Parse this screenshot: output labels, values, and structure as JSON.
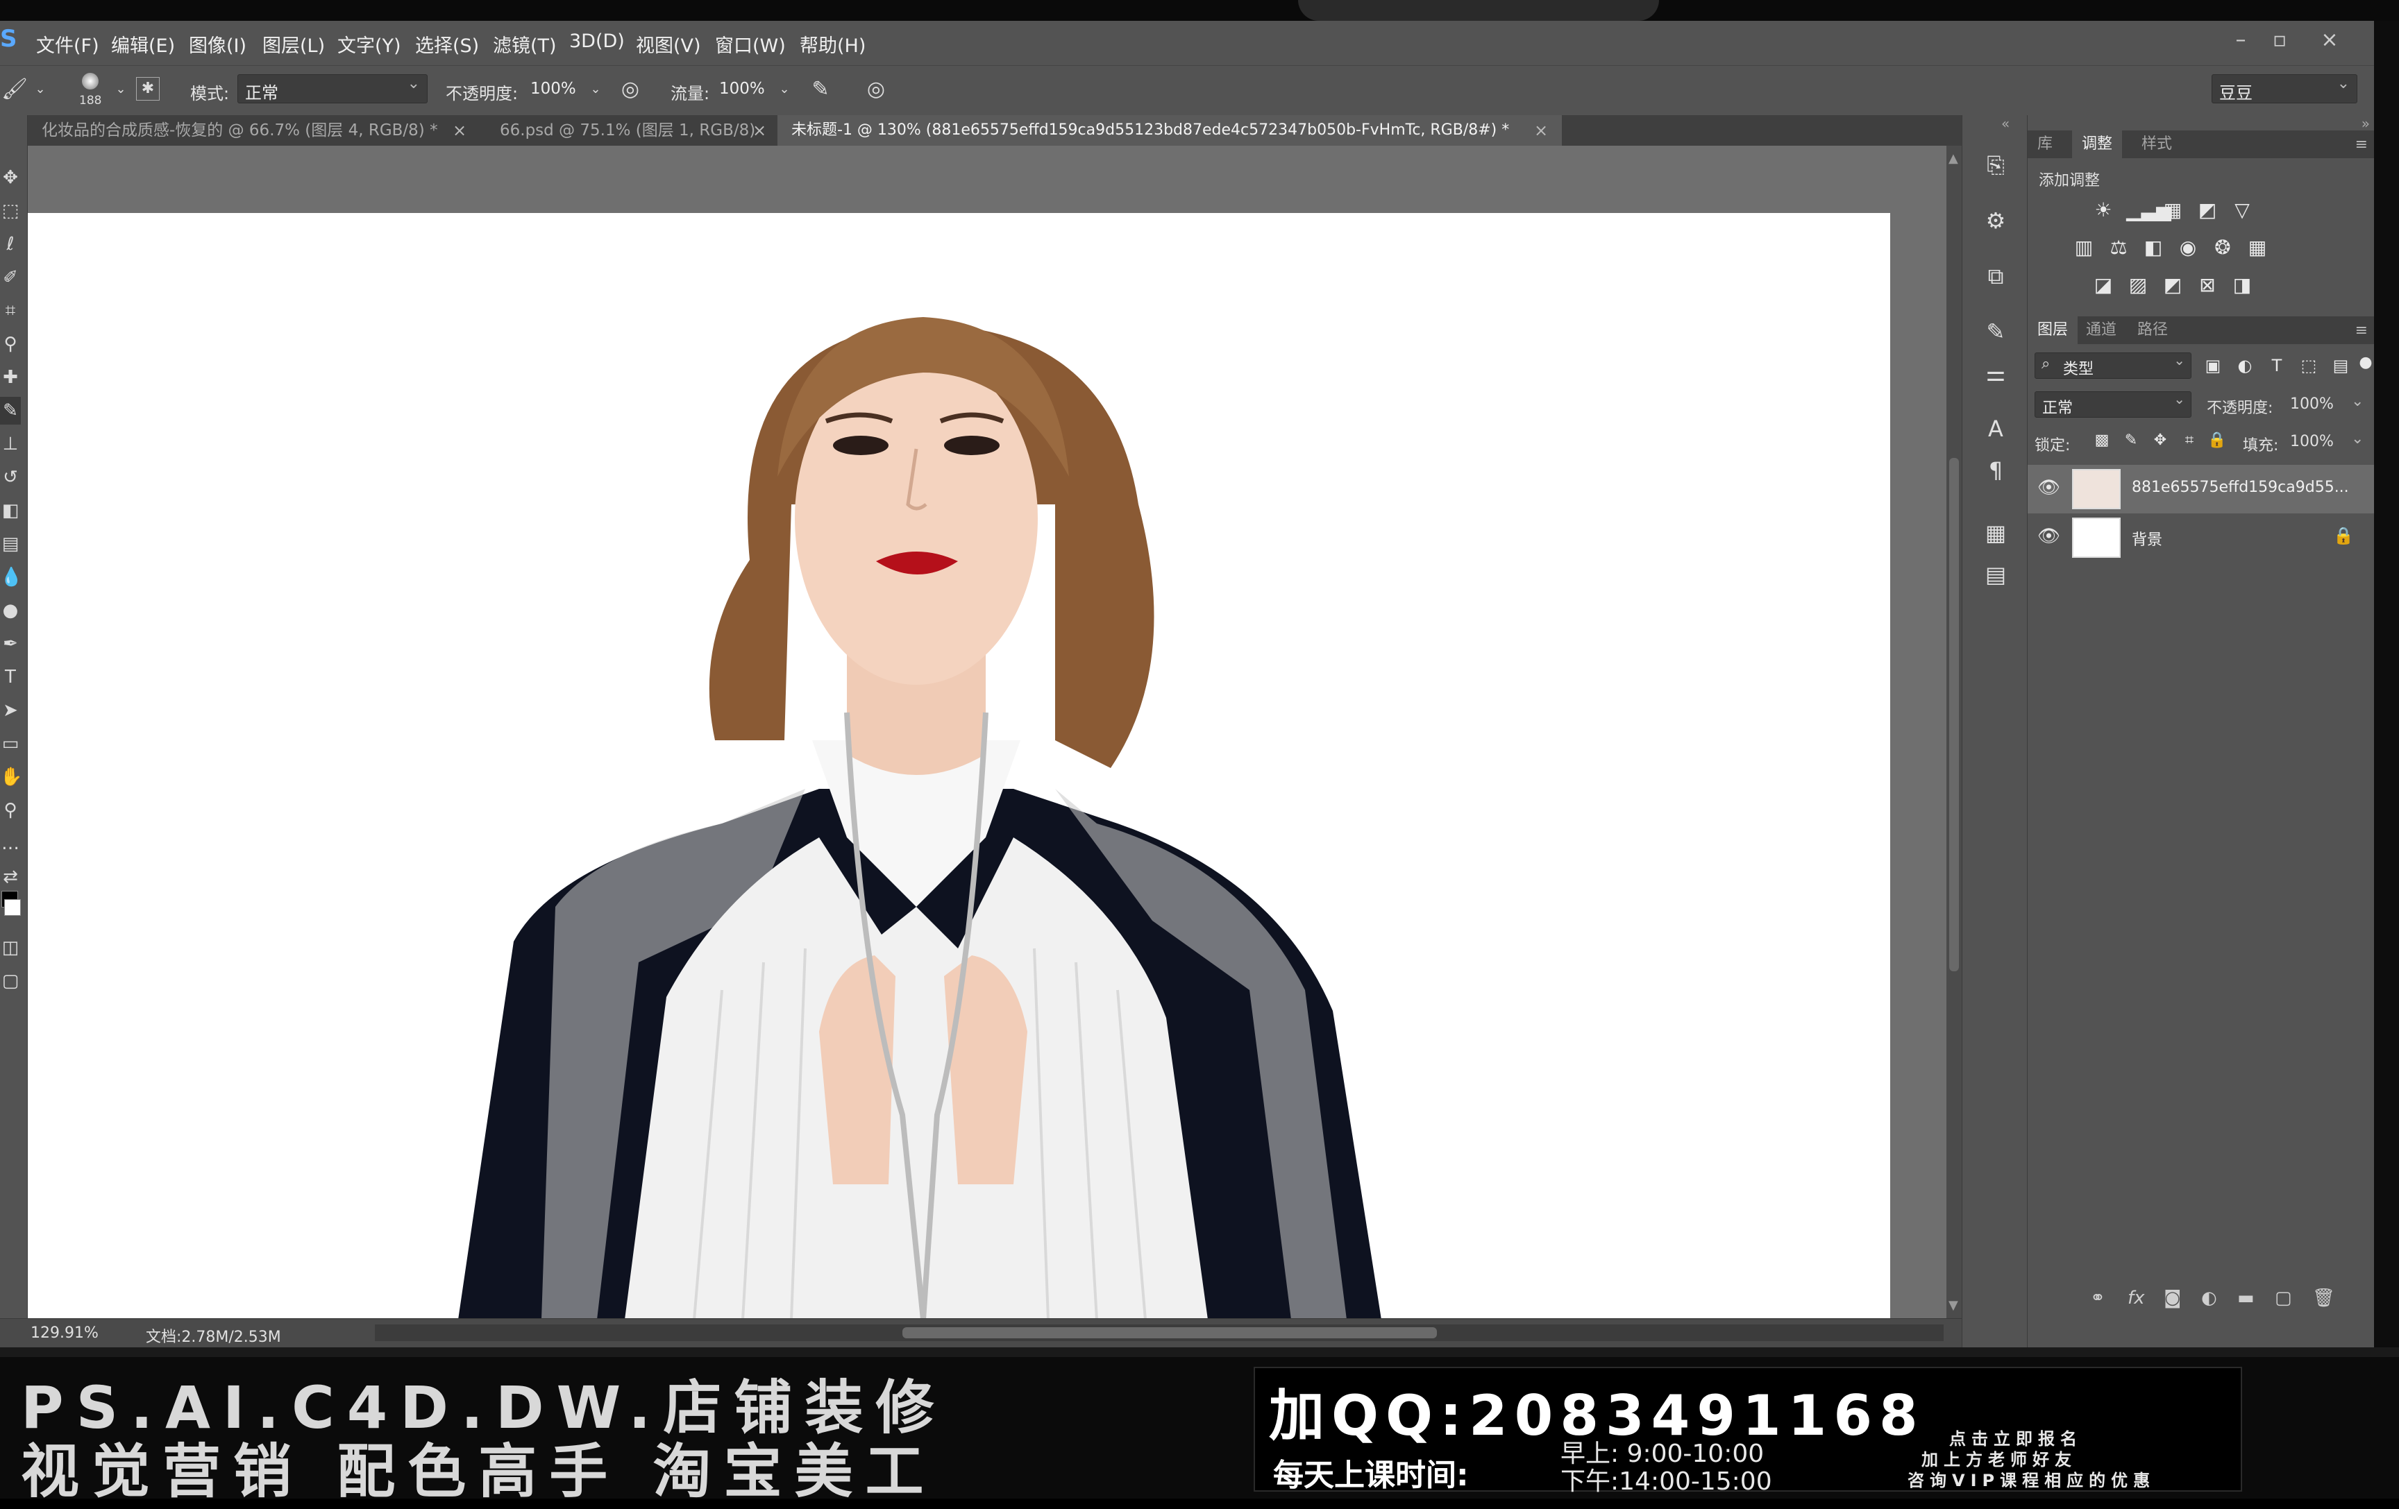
{
  "app": {
    "logo": "S"
  },
  "menu": [
    "文件(F)",
    "编辑(E)",
    "图像(I)",
    "图层(L)",
    "文字(Y)",
    "选择(S)",
    "滤镜(T)",
    "3D(D)",
    "视图(V)",
    "窗口(W)",
    "帮助(H)"
  ],
  "options": {
    "brush_size": "188",
    "mode_label": "模式:",
    "mode_value": "正常",
    "opacity_label": "不透明度:",
    "opacity_value": "100%",
    "flow_label": "流量:",
    "flow_value": "100%",
    "workspace": "豆豆"
  },
  "tabs": [
    {
      "label": "化妆品的合成质感-恢复的 @ 66.7% (图层 4, RGB/8) *",
      "active": false
    },
    {
      "label": "66.psd @ 75.1% (图层 1, RGB/8)",
      "active": false
    },
    {
      "label": "未标题-1 @ 130% (881e65575effd159ca9d55123bd87ede4c572347b050b-FvHmTc, RGB/8#) *",
      "active": true
    }
  ],
  "status": {
    "zoom": "129.91%",
    "doc": "文档:2.78M/2.53M"
  },
  "panels": {
    "top_tabs": [
      "库",
      "调整",
      "样式"
    ],
    "adjust_title": "添加调整",
    "layer_tabs": [
      "图层",
      "通道",
      "路径"
    ],
    "filter_kind": "类型",
    "blend_mode": "正常",
    "opacity_label": "不透明度:",
    "opacity_value": "100%",
    "lock_label": "锁定:",
    "fill_label": "填充:",
    "fill_value": "100%",
    "layers": [
      {
        "name": "881e65575effd159ca9d55...",
        "selected": true,
        "locked": false
      },
      {
        "name": "背景",
        "selected": false,
        "locked": true
      }
    ]
  },
  "banner": {
    "line1": "PS.AI.C4D.DW.店铺装修",
    "line2": "视觉营销 配色高手 淘宝美工",
    "qq": "加QQ:2083491168",
    "time_label": "每天上课时间:",
    "time_am": "早上: 9:00-10:00",
    "time_pm": "下午:14:00-15:00",
    "note1": "点击立即报名",
    "note2": "加上方老师好友",
    "note3": "咨询VIP课程相应的优惠"
  },
  "colors": {
    "ui_bg": "#535353",
    "canvas_bg": "#6f6f6f",
    "document": "#ffffff",
    "banner_bg": "#0b0b0b"
  }
}
